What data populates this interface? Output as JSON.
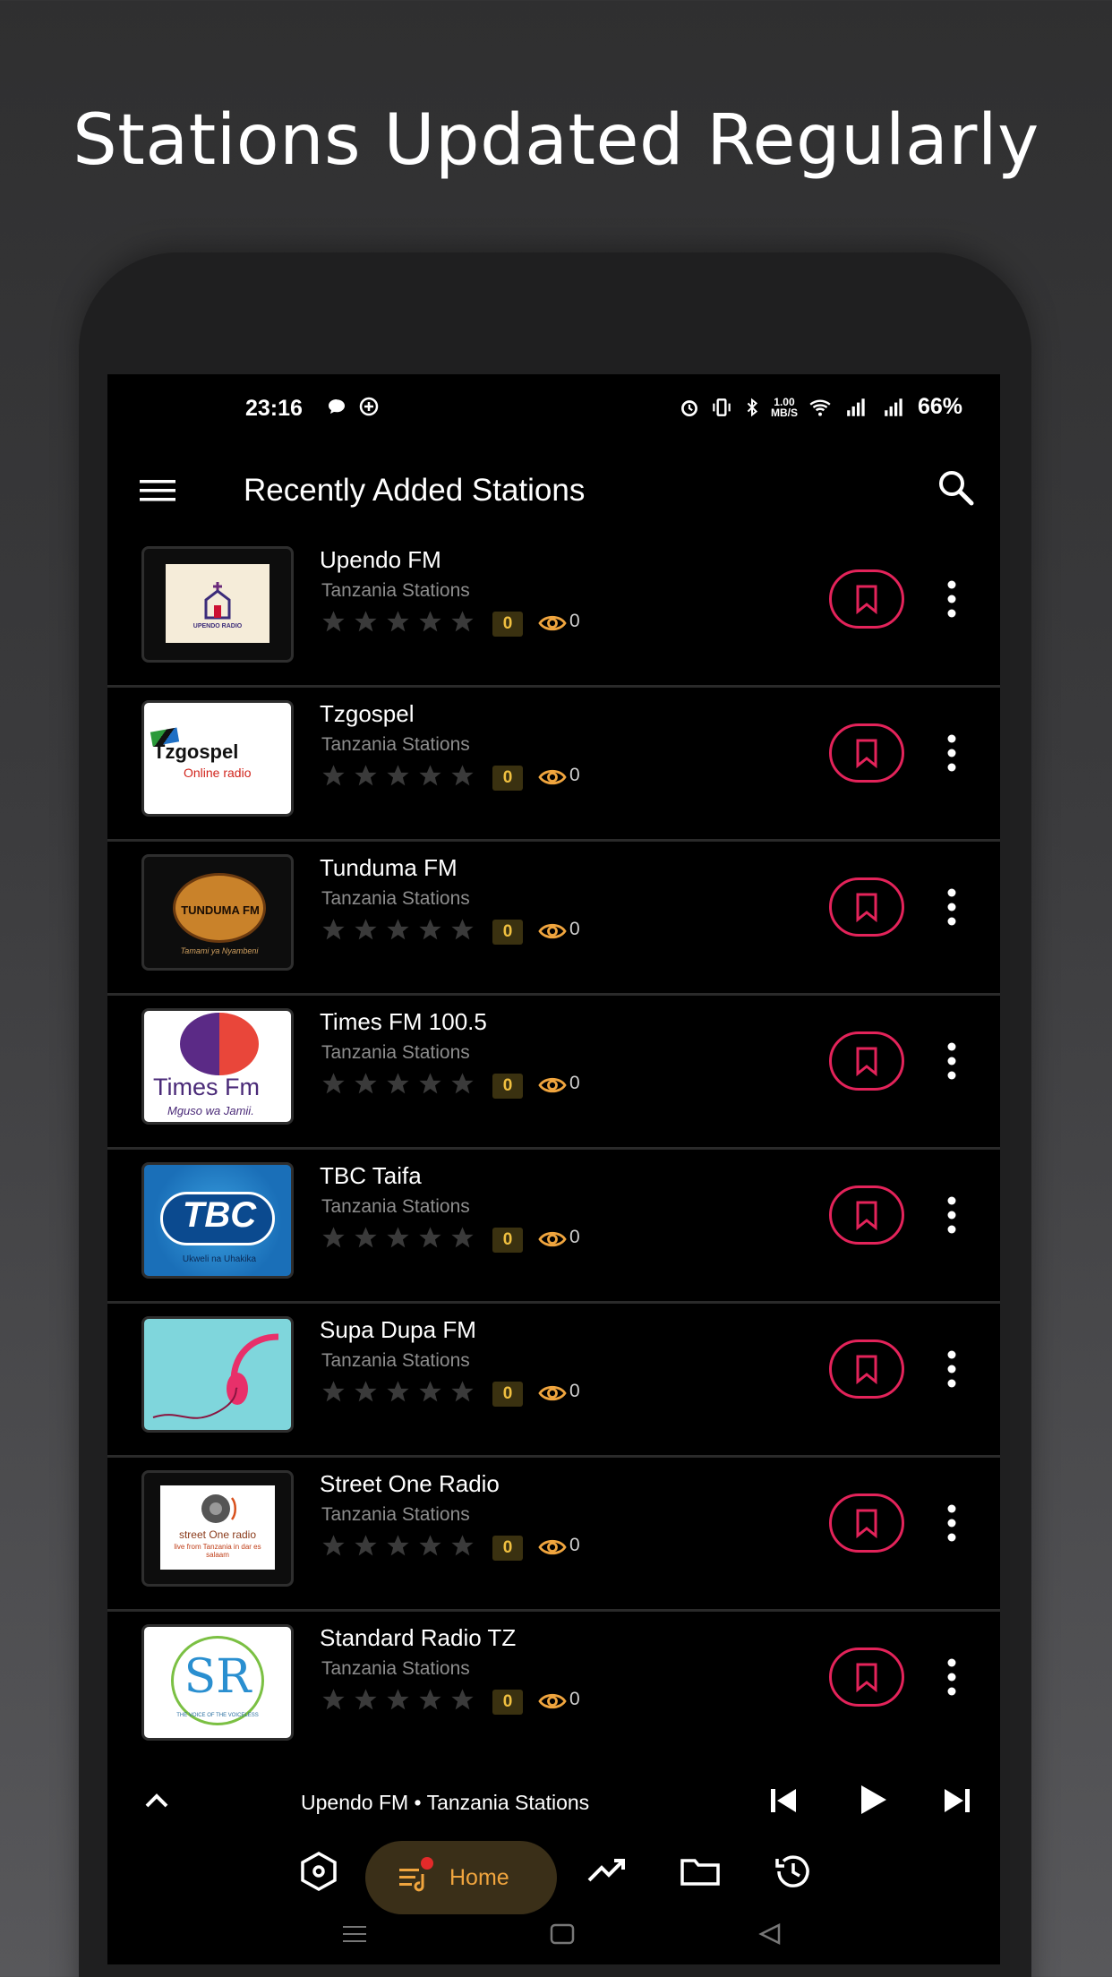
{
  "headline": "Stations Updated Regularly",
  "status_bar": {
    "time": "23:16",
    "speed_top": "1.00",
    "speed_unit": "MB/S",
    "battery": "66%"
  },
  "app_bar": {
    "title": "Recently Added Stations"
  },
  "stations": [
    {
      "name": "Upendo FM",
      "category": "Tanzania Stations",
      "rating": "0",
      "views": "0",
      "logo_text": "UPENDO RADIO"
    },
    {
      "name": "Tzgospel",
      "category": "Tanzania Stations",
      "rating": "0",
      "views": "0",
      "logo_text": "Tzgospel",
      "logo_sub": "Online radio"
    },
    {
      "name": "Tunduma FM",
      "category": "Tanzania Stations",
      "rating": "0",
      "views": "0",
      "logo_text": "TUNDUMA FM",
      "logo_sub": "Tamami ya Nyambeni"
    },
    {
      "name": "Times FM 100.5",
      "category": "Tanzania Stations",
      "rating": "0",
      "views": "0",
      "logo_text": "Times Fm",
      "logo_sub": "Mguso wa Jamii."
    },
    {
      "name": "TBC Taifa",
      "category": "Tanzania Stations",
      "rating": "0",
      "views": "0",
      "logo_text": "TBC",
      "logo_sub": "Ukweli na Uhakika"
    },
    {
      "name": "Supa Dupa FM",
      "category": "Tanzania Stations",
      "rating": "0",
      "views": "0"
    },
    {
      "name": "Street One Radio",
      "category": "Tanzania Stations",
      "rating": "0",
      "views": "0",
      "logo_text": "street One radio",
      "logo_sub": "live from Tanzania in dar es salaam"
    },
    {
      "name": "Standard Radio TZ",
      "category": "Tanzania Stations",
      "rating": "0",
      "views": "0",
      "logo_text": "SR",
      "logo_sub": "THE VOICE OF THE VOICELESS"
    }
  ],
  "player": {
    "now_playing": "Upendo FM • Tanzania Stations"
  },
  "bottom_nav": {
    "home_label": "Home"
  },
  "colors": {
    "accent_pink": "#e3235a",
    "accent_orange": "#f0a53e",
    "background": "#000000"
  }
}
